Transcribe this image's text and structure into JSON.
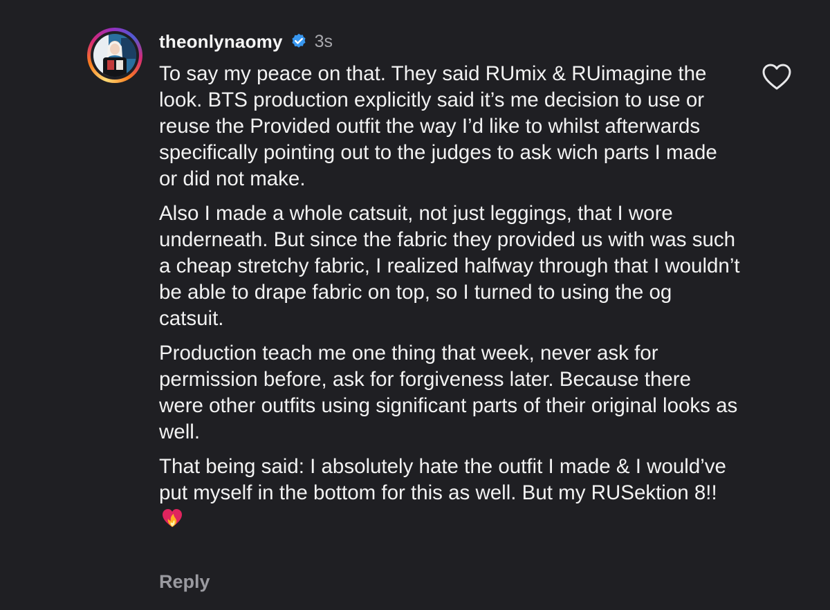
{
  "comment": {
    "username": "theonlynaomy",
    "verified": true,
    "timestamp": "3s",
    "paragraphs": [
      "To say my peace on that. They said RUmix & RUimagine the look. BTS production explicitly said it’s me decision to use or reuse the Provided outfit the way I’d like to whilst afterwards specifically pointing out to the judges to ask wich parts I made or did not make.",
      "Also I made a whole catsuit, not just leggings, that I wore underneath. But since the fabric they provided us with was such a cheap stretchy fabric, I realized halfway through that I wouldn’t be able to drape fabric on top, so I turned to using the og catsuit.",
      "Production teach me one thing that week, never ask for permission before, ask for forgiveness later. Because there were other outfits using significant parts of their original looks as well.",
      "That being said: I absolutely hate the outfit I made & I would’ve put myself in the bottom for this as well. But my RUSektion 8!!"
    ],
    "reply_label": "Reply"
  },
  "icons": {
    "verified": "verified-badge-icon",
    "like": "heart-outline-icon",
    "emoji": "heart-on-fire-emoji"
  },
  "colors": {
    "background": "#1f1f23",
    "text": "#f2f2f2",
    "muted": "#a8a8ad",
    "verified": "#3897f0",
    "reply": "#9a9aa0"
  }
}
